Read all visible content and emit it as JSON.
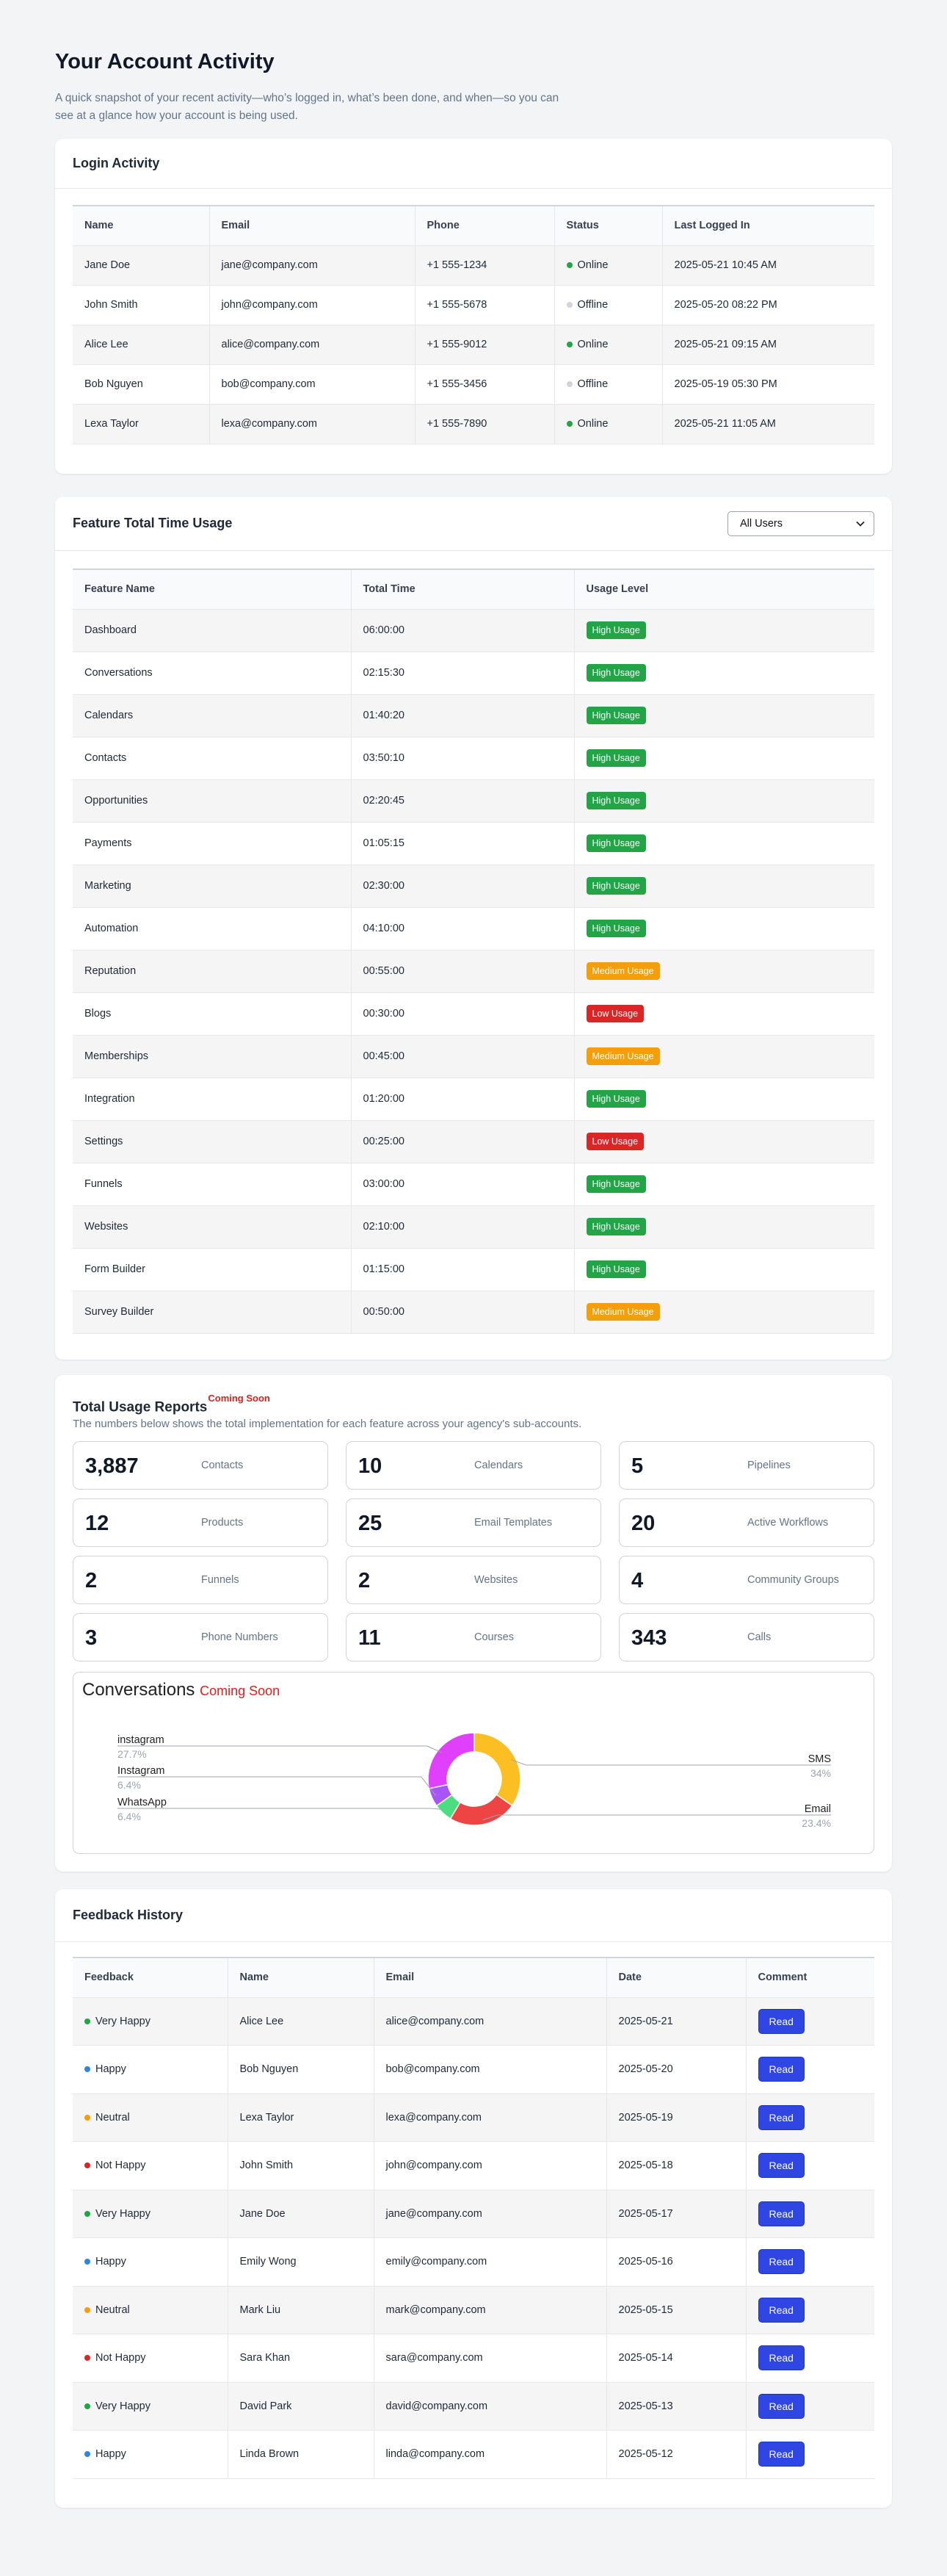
{
  "header": {
    "title": "Your Account Activity",
    "subtitle": "A quick snapshot of your recent activity—who’s logged in, what’s been done, and when—so you can see at a glance how your account is being used."
  },
  "login": {
    "title": "Login Activity",
    "columns": [
      "Name",
      "Email",
      "Phone",
      "Status",
      "Last Logged In"
    ],
    "rows": [
      {
        "name": "Jane Doe",
        "email": "jane@company.com",
        "phone": "+1 555-1234",
        "status": "Online",
        "last": "2025-05-21 10:45 AM"
      },
      {
        "name": "John Smith",
        "email": "john@company.com",
        "phone": "+1 555-5678",
        "status": "Offline",
        "last": "2025-05-20 08:22 PM"
      },
      {
        "name": "Alice Lee",
        "email": "alice@company.com",
        "phone": "+1 555-9012",
        "status": "Online",
        "last": "2025-05-21 09:15 AM"
      },
      {
        "name": "Bob Nguyen",
        "email": "bob@company.com",
        "phone": "+1 555-3456",
        "status": "Offline",
        "last": "2025-05-19 05:30 PM"
      },
      {
        "name": "Lexa Taylor",
        "email": "lexa@company.com",
        "phone": "+1 555-7890",
        "status": "Online",
        "last": "2025-05-21 11:05 AM"
      }
    ]
  },
  "feature": {
    "title": "Feature Total Time Usage",
    "filter": "All Users",
    "columns": [
      "Feature Name",
      "Total Time",
      "Usage Level"
    ],
    "rows": [
      {
        "name": "Dashboard",
        "time": "06:00:00",
        "level": "High Usage"
      },
      {
        "name": "Conversations",
        "time": "02:15:30",
        "level": "High Usage"
      },
      {
        "name": "Calendars",
        "time": "01:40:20",
        "level": "High Usage"
      },
      {
        "name": "Contacts",
        "time": "03:50:10",
        "level": "High Usage"
      },
      {
        "name": "Opportunities",
        "time": "02:20:45",
        "level": "High Usage"
      },
      {
        "name": "Payments",
        "time": "01:05:15",
        "level": "High Usage"
      },
      {
        "name": "Marketing",
        "time": "02:30:00",
        "level": "High Usage"
      },
      {
        "name": "Automation",
        "time": "04:10:00",
        "level": "High Usage"
      },
      {
        "name": "Reputation",
        "time": "00:55:00",
        "level": "Medium Usage"
      },
      {
        "name": "Blogs",
        "time": "00:30:00",
        "level": "Low Usage"
      },
      {
        "name": "Memberships",
        "time": "00:45:00",
        "level": "Medium Usage"
      },
      {
        "name": "Integration",
        "time": "01:20:00",
        "level": "High Usage"
      },
      {
        "name": "Settings",
        "time": "00:25:00",
        "level": "Low Usage"
      },
      {
        "name": "Funnels",
        "time": "03:00:00",
        "level": "High Usage"
      },
      {
        "name": "Websites",
        "time": "02:10:00",
        "level": "High Usage"
      },
      {
        "name": "Form Builder",
        "time": "01:15:00",
        "level": "High Usage"
      },
      {
        "name": "Survey Builder",
        "time": "00:50:00",
        "level": "Medium Usage"
      }
    ]
  },
  "usage": {
    "title": "Total Usage Reports",
    "coming_soon": "Coming Soon",
    "description": "The numbers below shows the total implementation for each feature across your agency's sub-accounts.",
    "stats": [
      {
        "value": "3,887",
        "label": "Contacts"
      },
      {
        "value": "10",
        "label": "Calendars"
      },
      {
        "value": "5",
        "label": "Pipelines"
      },
      {
        "value": "12",
        "label": "Products"
      },
      {
        "value": "25",
        "label": "Email Templates"
      },
      {
        "value": "20",
        "label": "Active Workflows"
      },
      {
        "value": "2",
        "label": "Funnels"
      },
      {
        "value": "2",
        "label": "Websites"
      },
      {
        "value": "4",
        "label": "Community Groups"
      },
      {
        "value": "3",
        "label": "Phone Numbers"
      },
      {
        "value": "11",
        "label": "Courses"
      },
      {
        "value": "343",
        "label": "Calls"
      }
    ],
    "conversations_title": "Conversations",
    "conversations_coming_soon": "Coming Soon"
  },
  "chart_data": {
    "type": "pie",
    "slices": [
      {
        "label": "SMS",
        "value": 34.0,
        "pct": "34%",
        "color": "#fbbf24"
      },
      {
        "label": "Email",
        "value": 23.4,
        "pct": "23.4%",
        "color": "#ef4444"
      },
      {
        "label": "WhatsApp",
        "value": 6.4,
        "pct": "6.4%",
        "color": "#4ade80"
      },
      {
        "label": "Instagram",
        "value": 6.4,
        "pct": "6.4%",
        "color": "#a855f7"
      },
      {
        "label": "instagram",
        "value": 27.7,
        "pct": "27.7%",
        "color": "#e040fb"
      }
    ]
  },
  "feedback": {
    "title": "Feedback History",
    "columns": [
      "Feedback",
      "Name",
      "Email",
      "Date",
      "Comment"
    ],
    "button_label": "Read",
    "rows": [
      {
        "feedback": "Very Happy",
        "name": "Alice Lee",
        "email": "alice@company.com",
        "date": "2025-05-21"
      },
      {
        "feedback": "Happy",
        "name": "Bob Nguyen",
        "email": "bob@company.com",
        "date": "2025-05-20"
      },
      {
        "feedback": "Neutral",
        "name": "Lexa Taylor",
        "email": "lexa@company.com",
        "date": "2025-05-19"
      },
      {
        "feedback": "Not Happy",
        "name": "John Smith",
        "email": "john@company.com",
        "date": "2025-05-18"
      },
      {
        "feedback": "Very Happy",
        "name": "Jane Doe",
        "email": "jane@company.com",
        "date": "2025-05-17"
      },
      {
        "feedback": "Happy",
        "name": "Emily Wong",
        "email": "emily@company.com",
        "date": "2025-05-16"
      },
      {
        "feedback": "Neutral",
        "name": "Mark Liu",
        "email": "mark@company.com",
        "date": "2025-05-15"
      },
      {
        "feedback": "Not Happy",
        "name": "Sara Khan",
        "email": "sara@company.com",
        "date": "2025-05-14"
      },
      {
        "feedback": "Very Happy",
        "name": "David Park",
        "email": "david@company.com",
        "date": "2025-05-13"
      },
      {
        "feedback": "Happy",
        "name": "Linda Brown",
        "email": "linda@company.com",
        "date": "2025-05-12"
      }
    ]
  },
  "colors": {
    "online": "#22a447",
    "offline": "#d1d5db",
    "high": "#22a447",
    "medium": "#f59e0b",
    "low": "#dc2626",
    "very_happy": "#22a447",
    "happy": "#2f86e0",
    "neutral": "#f59e0b",
    "not_happy": "#dc2626",
    "coming_soon": "#e11d1d",
    "read_button": "#2f46e3"
  }
}
